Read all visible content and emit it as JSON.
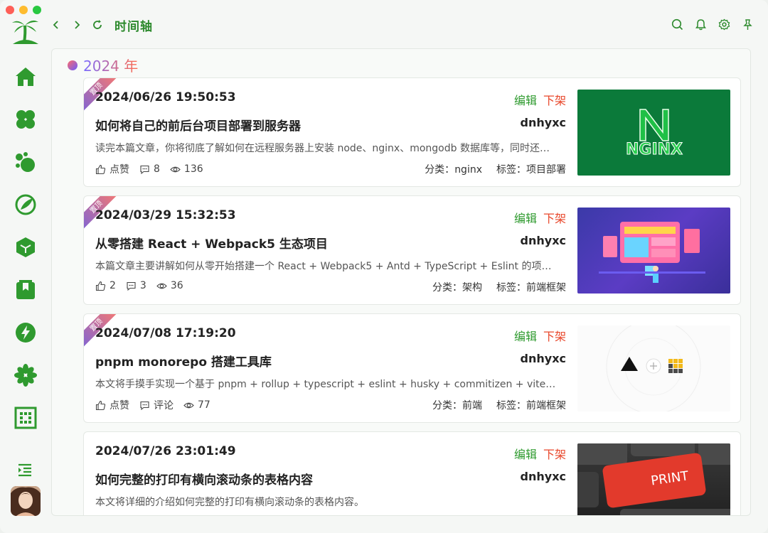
{
  "window": {
    "page_title": "时间轴"
  },
  "year_label": "2024 年",
  "pin_label": "置顶",
  "actions": {
    "edit": "编辑",
    "down": "下架"
  },
  "labels": {
    "category": "分类：",
    "tag": "标签："
  },
  "articles": [
    {
      "pinned": true,
      "date": "2024/06/26 19:50:53",
      "title": "如何将自己的前后台项目部署到服务器",
      "author": "dnhyxc",
      "desc": "读完本篇文章，你将彻底了解如何在远程服务器上安装 node、nginx、mongodb 数据库等，同时还能…",
      "likes": "点赞",
      "comments": "8",
      "views": "136",
      "category": "nginx",
      "tag": "项目部署",
      "thumb": "nginx",
      "thumb_text": "NGINX"
    },
    {
      "pinned": true,
      "date": "2024/03/29 15:32:53",
      "title": "从零搭建 React + Webpack5 生态项目",
      "author": "dnhyxc",
      "desc": "本篇文章主要讲解如何从零开始搭建一个 React + Webpack5 + Antd + TypeScript + Eslint 的项目，…",
      "likes": "2",
      "comments": "3",
      "views": "36",
      "category": "架构",
      "tag": "前端框架",
      "thumb": "react"
    },
    {
      "pinned": true,
      "date": "2024/07/08 17:19:20",
      "title": "pnpm monorepo 搭建工具库",
      "author": "dnhyxc",
      "desc": "本文将手摸手实现一个基于 pnpm + rollup + typescript + eslint + husky + commitizen + vitest + cha…",
      "likes": "点赞",
      "comments": "评论",
      "views": "77",
      "category": "前端",
      "tag": "前端框架",
      "thumb": "pnpm"
    },
    {
      "pinned": false,
      "date": "2024/07/26 23:01:49",
      "title": "如何完整的打印有横向滚动条的表格内容",
      "author": "dnhyxc",
      "desc": "本文将详细的介绍如何完整的打印有横向滚动条的表格内容。",
      "thumb": "print",
      "thumb_text": "PRINT"
    }
  ],
  "colors": {
    "accent": "#2d8a2d",
    "edit": "#2e9a2e",
    "down": "#e8472b"
  },
  "icons": {
    "sidebar": [
      "home-icon",
      "clover-icon",
      "bubbles-icon",
      "compass-icon",
      "cube-icon",
      "bookmark-icon",
      "bolt-icon",
      "flower-icon",
      "qrcode-icon"
    ]
  }
}
